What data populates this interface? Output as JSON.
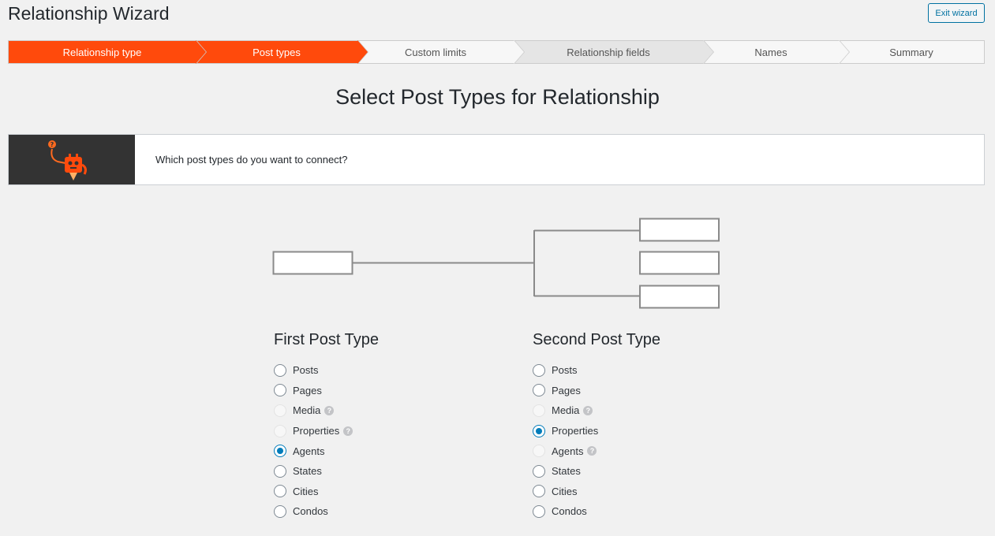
{
  "header": {
    "title": "Relationship Wizard",
    "exit_label": "Exit wizard"
  },
  "steps": [
    {
      "label": "Relationship type",
      "state": "done"
    },
    {
      "label": "Post types",
      "state": "current"
    },
    {
      "label": "Custom limits",
      "state": "default"
    },
    {
      "label": "Relationship fields",
      "state": "pending"
    },
    {
      "label": "Names",
      "state": "default"
    },
    {
      "label": "Summary",
      "state": "default"
    }
  ],
  "main": {
    "heading": "Select Post Types for Relationship",
    "intro_text": "Which post types do you want to connect?",
    "help_icon_glyph": "?"
  },
  "first": {
    "heading": "First Post Type",
    "options": [
      {
        "label": "Posts",
        "checked": false,
        "disabled": false
      },
      {
        "label": "Pages",
        "checked": false,
        "disabled": false
      },
      {
        "label": "Media",
        "checked": false,
        "disabled": true
      },
      {
        "label": "Properties",
        "checked": false,
        "disabled": true
      },
      {
        "label": "Agents",
        "checked": true,
        "disabled": false
      },
      {
        "label": "States",
        "checked": false,
        "disabled": false
      },
      {
        "label": "Cities",
        "checked": false,
        "disabled": false
      },
      {
        "label": "Condos",
        "checked": false,
        "disabled": false
      }
    ]
  },
  "second": {
    "heading": "Second Post Type",
    "options": [
      {
        "label": "Posts",
        "checked": false,
        "disabled": false
      },
      {
        "label": "Pages",
        "checked": false,
        "disabled": false
      },
      {
        "label": "Media",
        "checked": false,
        "disabled": true
      },
      {
        "label": "Properties",
        "checked": true,
        "disabled": false
      },
      {
        "label": "Agents",
        "checked": false,
        "disabled": true
      },
      {
        "label": "States",
        "checked": false,
        "disabled": false
      },
      {
        "label": "Cities",
        "checked": false,
        "disabled": false
      },
      {
        "label": "Condos",
        "checked": false,
        "disabled": false
      }
    ]
  },
  "colors": {
    "accent": "#ff4a0c",
    "primary": "#007cba",
    "pending": "#e5e5e5"
  }
}
